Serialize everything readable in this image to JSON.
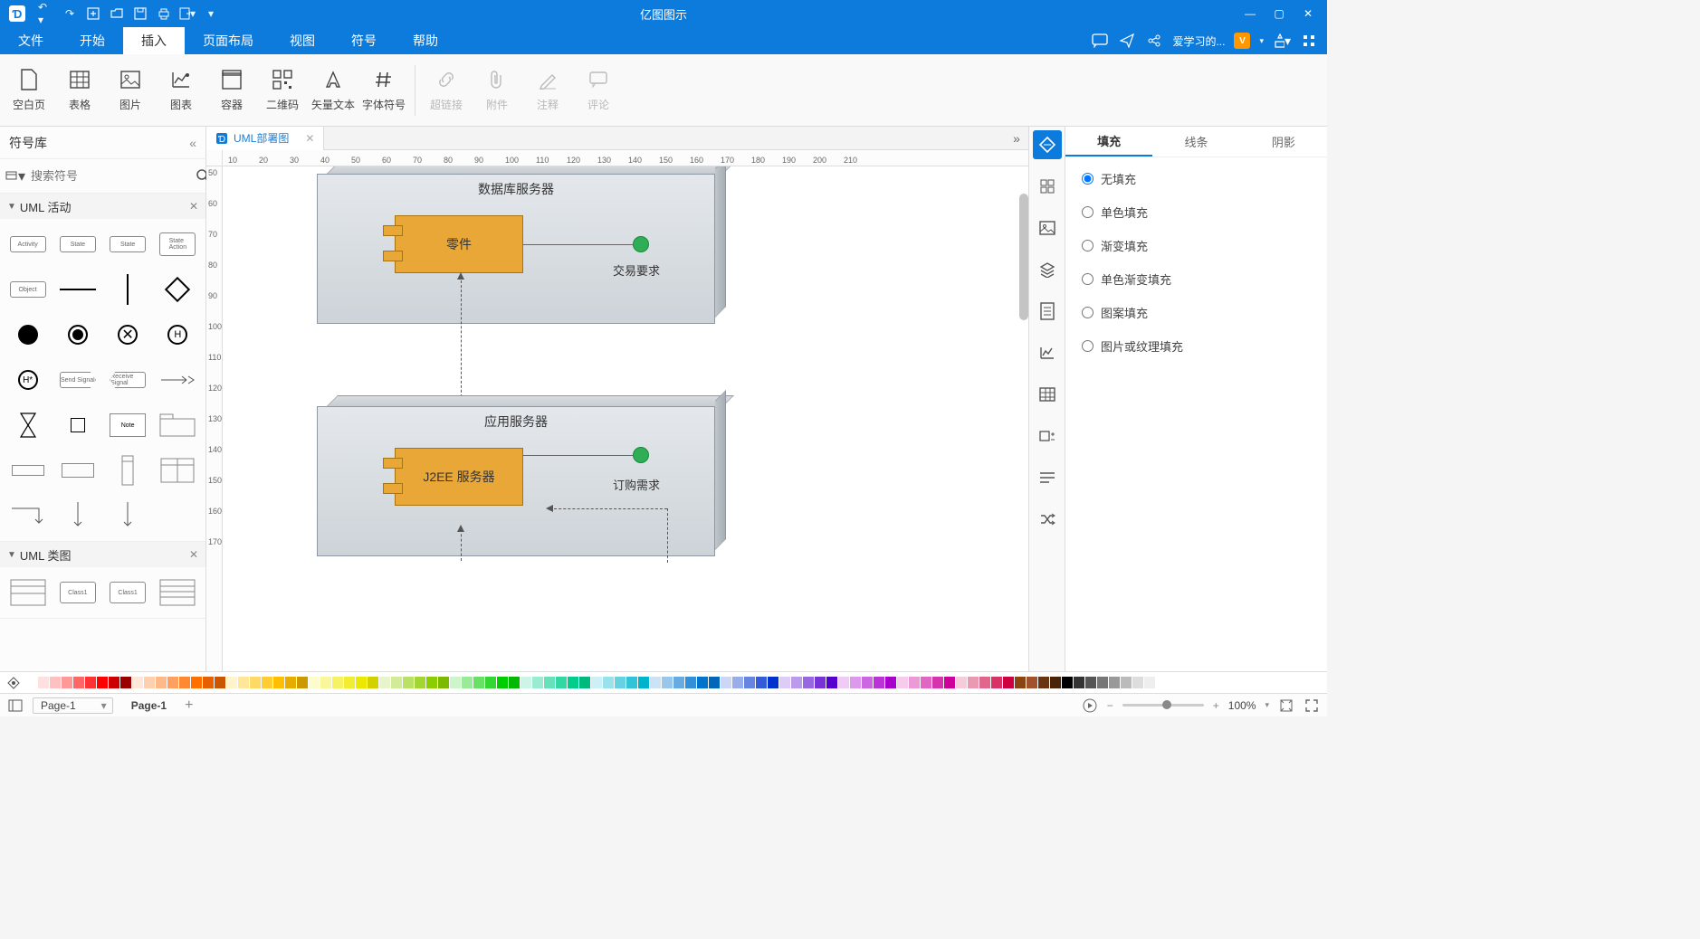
{
  "app_title": "亿图图示",
  "qat": [
    "undo",
    "redo",
    "new",
    "open",
    "save",
    "print",
    "export",
    "more"
  ],
  "win": [
    "min",
    "max",
    "close"
  ],
  "menus": [
    {
      "label": "文件",
      "active": false
    },
    {
      "label": "开始",
      "active": false
    },
    {
      "label": "插入",
      "active": true
    },
    {
      "label": "页面布局",
      "active": false
    },
    {
      "label": "视图",
      "active": false
    },
    {
      "label": "符号",
      "active": false
    },
    {
      "label": "帮助",
      "active": false
    }
  ],
  "menubar_right_user": "爱学习的...",
  "ribbon": [
    {
      "label": "空白页",
      "key": "blank-page",
      "icon": "page"
    },
    {
      "label": "表格",
      "key": "table",
      "icon": "table"
    },
    {
      "label": "图片",
      "key": "image",
      "icon": "image"
    },
    {
      "label": "图表",
      "key": "chart",
      "icon": "chart"
    },
    {
      "label": "容器",
      "key": "container",
      "icon": "container"
    },
    {
      "label": "二维码",
      "key": "qrcode",
      "icon": "qrcode"
    },
    {
      "label": "矢量文本",
      "key": "vector-text",
      "icon": "vtext"
    },
    {
      "label": "字体符号",
      "key": "font-symbol",
      "icon": "hash"
    }
  ],
  "ribbon_disabled": [
    {
      "label": "超链接",
      "key": "hyperlink"
    },
    {
      "label": "附件",
      "key": "attachment"
    },
    {
      "label": "注释",
      "key": "note"
    },
    {
      "label": "评论",
      "key": "comment"
    }
  ],
  "left_panel": {
    "title": "符号库",
    "search_placeholder": "搜索符号",
    "sections": [
      {
        "title": "UML 活动"
      },
      {
        "title": "UML 类图"
      }
    ]
  },
  "doc_tabs": [
    {
      "label": "UML部署图"
    }
  ],
  "ruler_h": [
    10,
    20,
    30,
    40,
    50,
    60,
    70,
    80,
    90,
    100,
    110,
    120,
    130,
    140,
    150,
    160,
    170,
    180,
    190,
    200,
    210
  ],
  "ruler_v": [
    50,
    60,
    70,
    80,
    90,
    100,
    110,
    120,
    130,
    140,
    150,
    160,
    170
  ],
  "diagram": {
    "node1": {
      "title": "数据库服务器",
      "component": "零件",
      "port_label": "交易要求"
    },
    "node2": {
      "title": "应用服务器",
      "component": "J2EE 服务器",
      "port_label": "订购需求"
    }
  },
  "right_tabs": [
    {
      "label": "填充",
      "active": true
    },
    {
      "label": "线条",
      "active": false
    },
    {
      "label": "阴影",
      "active": false
    }
  ],
  "fill_options": [
    {
      "label": "无填充",
      "selected": true
    },
    {
      "label": "单色填充",
      "selected": false
    },
    {
      "label": "渐变填充",
      "selected": false
    },
    {
      "label": "单色渐变填充",
      "selected": false
    },
    {
      "label": "图案填充",
      "selected": false
    },
    {
      "label": "图片或纹理填充",
      "selected": false
    }
  ],
  "status": {
    "page_selector": "Page-1",
    "current_page": "Page-1",
    "zoom": "100%"
  },
  "rail_icons": [
    "style",
    "layout",
    "image",
    "layers",
    "page",
    "chart",
    "table",
    "arrange",
    "paragraph",
    "random"
  ],
  "colorbar": [
    "#ffffff",
    "#ffe0e0",
    "#ffc0c0",
    "#ff9999",
    "#ff6666",
    "#ff3333",
    "#ff0000",
    "#cc0000",
    "#990000",
    "#ffe8d9",
    "#ffd0b0",
    "#ffb888",
    "#ffa060",
    "#ff8833",
    "#ff7000",
    "#e66000",
    "#cc5500",
    "#fff4cc",
    "#ffe699",
    "#ffd966",
    "#ffcc33",
    "#ffbf00",
    "#e6ac00",
    "#cc9900",
    "#fdfccc",
    "#f9f799",
    "#f5f266",
    "#f0ed33",
    "#ece800",
    "#d4d100",
    "#e8f5cc",
    "#d1eb99",
    "#b9e166",
    "#a2d733",
    "#8bcd00",
    "#7db900",
    "#ccf5cc",
    "#99eb99",
    "#66e166",
    "#33d733",
    "#00cd00",
    "#00b900",
    "#ccf5e8",
    "#99ebd1",
    "#66e1b9",
    "#33d7a2",
    "#00cd8b",
    "#00b97d",
    "#ccf0f5",
    "#99e1eb",
    "#66d2e1",
    "#33c3d7",
    "#00b4cd",
    "#cce3f5",
    "#99c7eb",
    "#66abe1",
    "#338fd7",
    "#0073cd",
    "#0067b9",
    "#ccd6f5",
    "#99adeb",
    "#6684e1",
    "#335bd7",
    "#0032cd",
    "#ddccf5",
    "#bb99eb",
    "#9966e1",
    "#7733d7",
    "#5500cd",
    "#eeccf5",
    "#dd99eb",
    "#cc66e1",
    "#bb33d7",
    "#aa00cd",
    "#f5cceb",
    "#eb99d7",
    "#e166c3",
    "#d733af",
    "#cd009b",
    "#f5ccd9",
    "#eb99b3",
    "#e1668c",
    "#d73366",
    "#cd0040",
    "#8b4513",
    "#a0522d",
    "#6b3410",
    "#4a2408",
    "#000000",
    "#333333",
    "#555555",
    "#777777",
    "#999999",
    "#bbbbbb",
    "#dddddd",
    "#eeeeee",
    "#ffffff"
  ]
}
